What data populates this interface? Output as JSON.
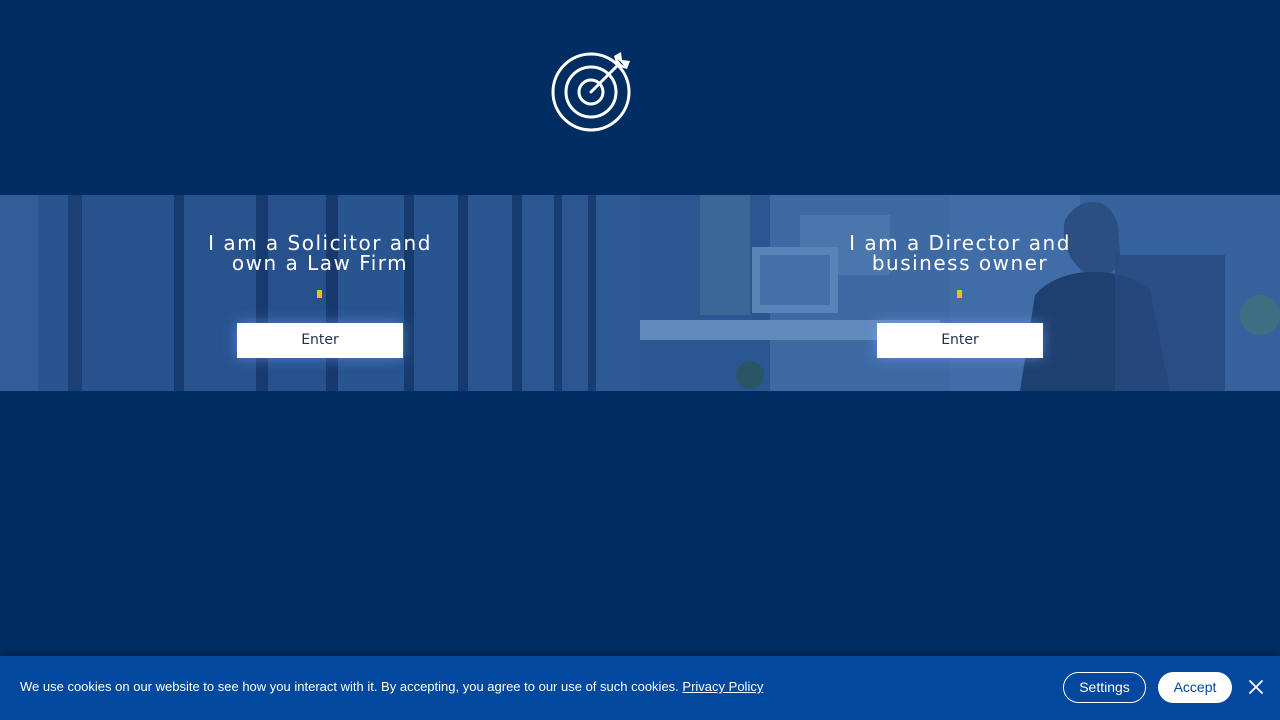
{
  "logo": {
    "icon": "target-arrow-icon"
  },
  "panels": [
    {
      "title": "I am a Solicitor and\nown a Law Firm",
      "button_label": "Enter",
      "background": "law-books-photo"
    },
    {
      "title": "I am a Director and\nbusiness owner",
      "button_label": "Enter",
      "background": "office-businessman-photo"
    }
  ],
  "cookie_banner": {
    "message": "We use cookies on our website to see how you interact with it. By accepting, you agree to our use of such cookies.",
    "privacy_link": "Privacy Policy",
    "settings_label": "Settings",
    "accept_label": "Accept",
    "close_icon": "close-icon"
  },
  "colors": {
    "page_bg": "#002d62",
    "accent": "#f2c200",
    "banner_bg": "#01489e",
    "button_text": "#1f2f55"
  }
}
